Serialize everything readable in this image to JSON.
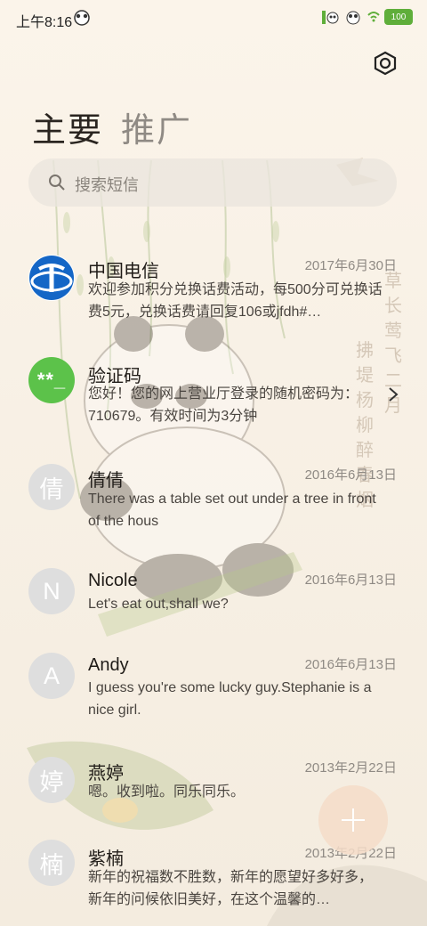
{
  "status_bar": {
    "time": "上午8:16",
    "battery": "100"
  },
  "header": {
    "title_primary": "主要",
    "title_secondary": "推广"
  },
  "search": {
    "placeholder": "搜索短信"
  },
  "conversations": [
    {
      "name": "中国电信",
      "date": "2017年6月30日",
      "preview": "欢迎参加积分兑换话费活动，每500分可兑换话费5元，兑换话费请回复106或jfdh#…",
      "avatar_type": "logo",
      "avatar_icon": "china-telecom-logo"
    },
    {
      "name": "验证码",
      "date": "",
      "preview": "您好！您的网上营业厅登录的随机密码为：710679。有效时间为3分钟",
      "avatar_type": "green",
      "avatar_text": "**_"
    },
    {
      "name": "倩倩",
      "date": "2016年6月13日",
      "preview": "There was a table set out under a tree in front of the hous",
      "avatar_type": "letter",
      "avatar_text": "倩"
    },
    {
      "name": "Nicole",
      "date": "2016年6月13日",
      "preview": "Let's eat out,shall we?",
      "avatar_type": "letter",
      "avatar_text": "N"
    },
    {
      "name": "Andy",
      "date": "2016年6月13日",
      "preview": "I guess you're some lucky guy.Stephanie is a nice girl.",
      "avatar_type": "letter",
      "avatar_text": "A"
    },
    {
      "name": "燕婷",
      "date": "2013年2月22日",
      "preview": "嗯。收到啦。同乐同乐。",
      "avatar_type": "letter",
      "avatar_text": "婷"
    },
    {
      "name": "紫楠",
      "date": "2013年2月22日",
      "preview": "新年的祝福数不胜数，新年的愿望好多好多，新年的问候依旧美好，在这个温馨的…",
      "avatar_type": "letter",
      "avatar_text": "楠"
    }
  ],
  "background_poem": "草长莺飞二月天 拂堤杨柳醉春烟",
  "colors": {
    "accent_green": "#5cc24a",
    "telecom_blue": "#1466c6",
    "avatar_gray": "#dedede",
    "fab": "#f4dcc8",
    "background": "#f7efe3"
  },
  "icons": {
    "settings": "hexagon-settings-icon",
    "search": "search-icon",
    "chevron": "chevron-right-icon",
    "fab": "plus-icon"
  }
}
